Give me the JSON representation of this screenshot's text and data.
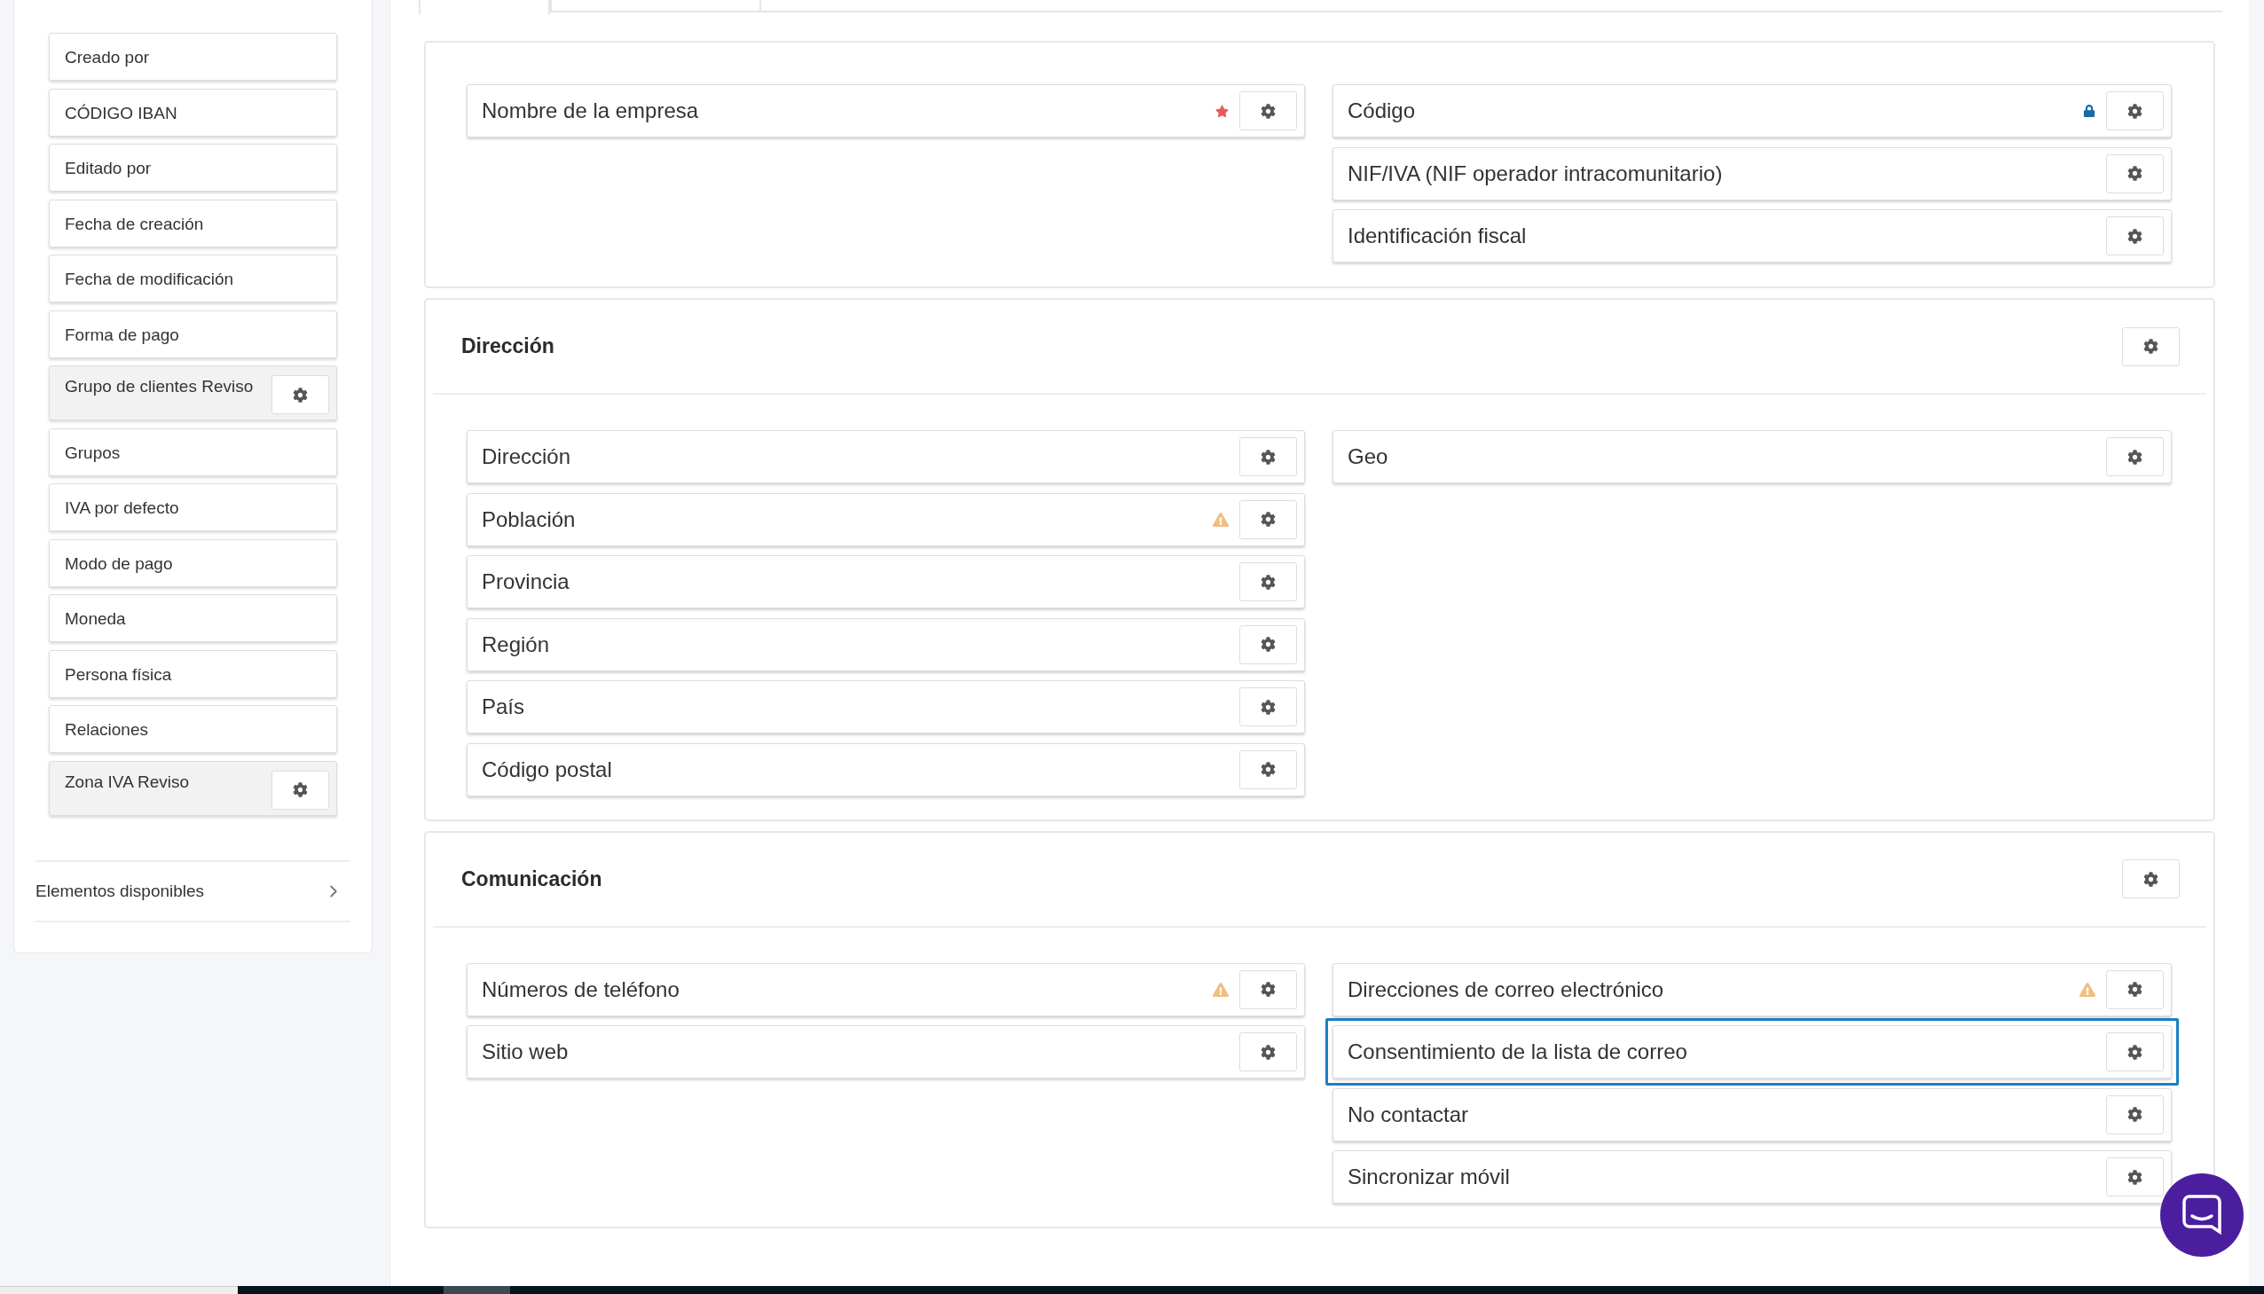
{
  "sidebar": {
    "items": [
      {
        "label": "Creado por",
        "configurable": false
      },
      {
        "label": "CÓDIGO IBAN",
        "configurable": false
      },
      {
        "label": "Editado por",
        "configurable": false
      },
      {
        "label": "Fecha de creación",
        "configurable": false
      },
      {
        "label": "Fecha de modificación",
        "configurable": false
      },
      {
        "label": "Forma de pago",
        "configurable": false
      },
      {
        "label": "Grupo de clientes Reviso",
        "configurable": true
      },
      {
        "label": "Grupos",
        "configurable": false
      },
      {
        "label": "IVA por defecto",
        "configurable": false
      },
      {
        "label": "Modo de pago",
        "configurable": false
      },
      {
        "label": "Moneda",
        "configurable": false
      },
      {
        "label": "Persona física",
        "configurable": false
      },
      {
        "label": "Relaciones",
        "configurable": false
      },
      {
        "label": "Zona IVA Reviso",
        "configurable": true
      }
    ],
    "available": {
      "label": "Elementos disponibles",
      "expanded": false
    }
  },
  "tabs": [
    {
      "selected": true
    },
    {
      "selected": false
    }
  ],
  "sections": [
    {
      "left": [
        {
          "label": "Nombre de la empresa",
          "required": true,
          "locked": false,
          "warning": false,
          "selected": false
        }
      ],
      "right": [
        {
          "label": "Código",
          "required": false,
          "locked": true,
          "warning": false,
          "selected": false
        },
        {
          "label": "NIF/IVA (NIF operador intracomunitario)",
          "required": false,
          "locked": false,
          "warning": false,
          "selected": false
        },
        {
          "label": "Identificación fiscal",
          "required": false,
          "locked": false,
          "warning": false,
          "selected": false
        }
      ]
    },
    {
      "title": "Dirección",
      "left": [
        {
          "label": "Dirección",
          "required": false,
          "locked": false,
          "warning": false,
          "selected": false
        },
        {
          "label": "Población",
          "required": false,
          "locked": false,
          "warning": true,
          "selected": false
        },
        {
          "label": "Provincia",
          "required": false,
          "locked": false,
          "warning": false,
          "selected": false
        },
        {
          "label": "Región",
          "required": false,
          "locked": false,
          "warning": false,
          "selected": false
        },
        {
          "label": "País",
          "required": false,
          "locked": false,
          "warning": false,
          "selected": false
        },
        {
          "label": "Código postal",
          "required": false,
          "locked": false,
          "warning": false,
          "selected": false
        }
      ],
      "right": [
        {
          "label": "Geo",
          "required": false,
          "locked": false,
          "warning": false,
          "selected": false
        }
      ]
    },
    {
      "title": "Comunicación",
      "left": [
        {
          "label": "Números de teléfono",
          "required": false,
          "locked": false,
          "warning": true,
          "selected": false
        },
        {
          "label": "Sitio web",
          "required": false,
          "locked": false,
          "warning": false,
          "selected": false
        }
      ],
      "right": [
        {
          "label": "Direcciones de correo electrónico",
          "required": false,
          "locked": false,
          "warning": true,
          "selected": false
        },
        {
          "label": "Consentimiento de la lista de correo",
          "required": false,
          "locked": false,
          "warning": false,
          "selected": true
        },
        {
          "label": "No contactar",
          "required": false,
          "locked": false,
          "warning": false,
          "selected": false
        },
        {
          "label": "Sincronizar móvil",
          "required": false,
          "locked": false,
          "warning": false,
          "selected": false
        }
      ]
    }
  ]
}
